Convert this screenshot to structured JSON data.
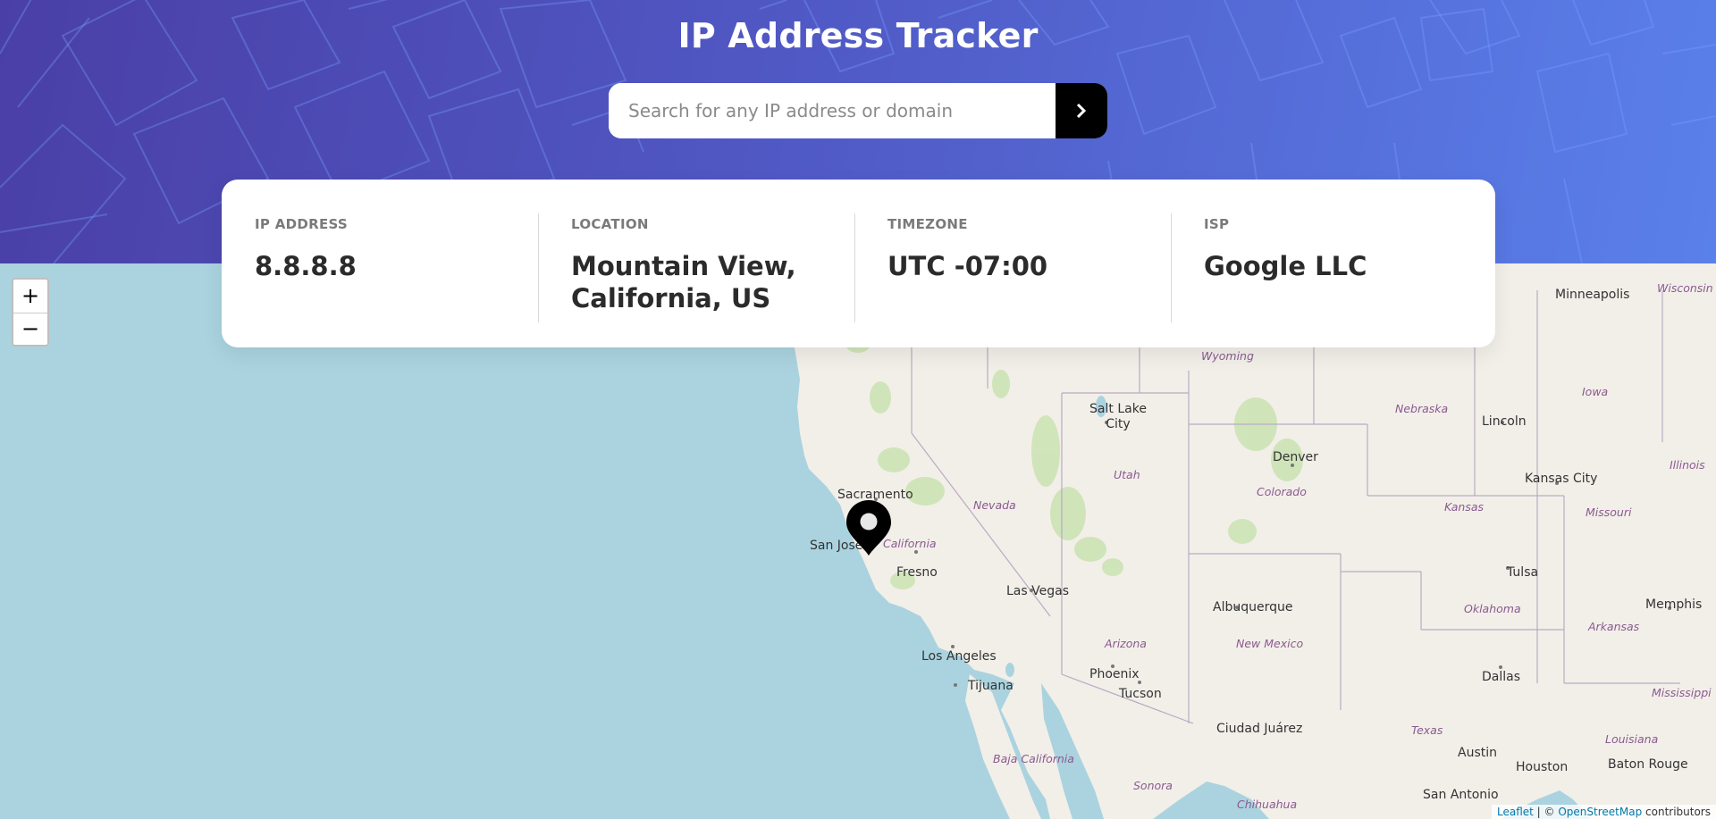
{
  "header": {
    "title": "IP Address Tracker",
    "search_placeholder": "Search for any IP address or domain",
    "search_value": "",
    "gradient_start": "#4a3fa6",
    "gradient_end": "#5a80ea"
  },
  "info": {
    "ip": {
      "label": "IP ADDRESS",
      "value": "8.8.8.8"
    },
    "location": {
      "label": "LOCATION",
      "value_line1": "Mountain View,",
      "value_line2": "California, US"
    },
    "timezone": {
      "label": "TIMEZONE",
      "value": "UTC -07:00"
    },
    "isp": {
      "label": "ISP",
      "value": "Google LLC"
    }
  },
  "map": {
    "zoom_in": "+",
    "zoom_out": "−",
    "cities": [
      "Minneapolis",
      "Salt Lake City",
      "Lincoln",
      "Denver",
      "Kansas City",
      "Sacramento",
      "San Jose",
      "Fresno",
      "Las Vegas",
      "Tulsa",
      "Memphis",
      "Albuquerque",
      "Los Angeles",
      "Phoenix",
      "Tijuana",
      "Tucson",
      "Dallas",
      "Ciudad Juárez",
      "Austin",
      "Houston",
      "Baton Rouge",
      "San Antonio"
    ],
    "states": [
      "Wisconsin",
      "Wyoming",
      "Iowa",
      "Nebraska",
      "Illinois",
      "Utah",
      "Nevada",
      "Colorado",
      "Kansas",
      "Missouri",
      "California",
      "Oklahoma",
      "Arkansas",
      "Arizona",
      "New Mexico",
      "Texas",
      "Mississippi",
      "Louisiana",
      "Baja California",
      "Sonora",
      "Chihuahua"
    ],
    "marker_icon": "location-pin-icon",
    "water_color": "#aad3df",
    "land_color": "#f2efe9"
  },
  "attribution": {
    "leaflet": "Leaflet",
    "separator": " | © ",
    "osm": "OpenStreetMap",
    "suffix": " contributors"
  }
}
